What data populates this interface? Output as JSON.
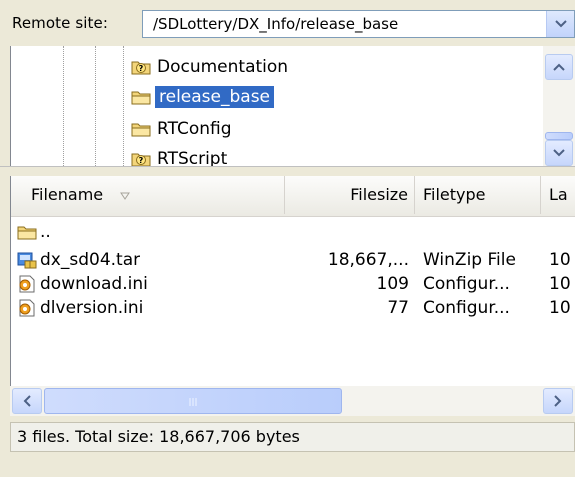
{
  "remote": {
    "label": "Remote site:",
    "path": "/SDLottery/DX_Info/release_base"
  },
  "tree": {
    "items": [
      {
        "label": "Documentation",
        "icon": "question-folder-icon",
        "selected": false
      },
      {
        "label": "release_base",
        "icon": "folder-icon",
        "selected": true
      },
      {
        "label": "RTConfig",
        "icon": "folder-icon",
        "selected": false
      },
      {
        "label": "RTScript",
        "icon": "question-folder-icon",
        "selected": false
      }
    ]
  },
  "filelist": {
    "columns": {
      "filename": "Filename",
      "filesize": "Filesize",
      "filetype": "Filetype",
      "lastmod": "La"
    },
    "rows": [
      {
        "name": "..",
        "size": "",
        "type": "",
        "mod": "",
        "icon": "folder-icon"
      },
      {
        "name": "dx_sd04.tar",
        "size": "18,667,...",
        "type": "WinZip File",
        "mod": "10",
        "icon": "winzip-icon"
      },
      {
        "name": "download.ini",
        "size": "109",
        "type": "Configur...",
        "mod": "10",
        "icon": "config-file-icon"
      },
      {
        "name": "dlversion.ini",
        "size": "77",
        "type": "Configur...",
        "mod": "10",
        "icon": "config-file-icon"
      }
    ]
  },
  "status": {
    "text": "3 files. Total size: 18,667,706 bytes"
  },
  "colors": {
    "selection": "#316ac5",
    "window_bg": "#ece9d8"
  }
}
